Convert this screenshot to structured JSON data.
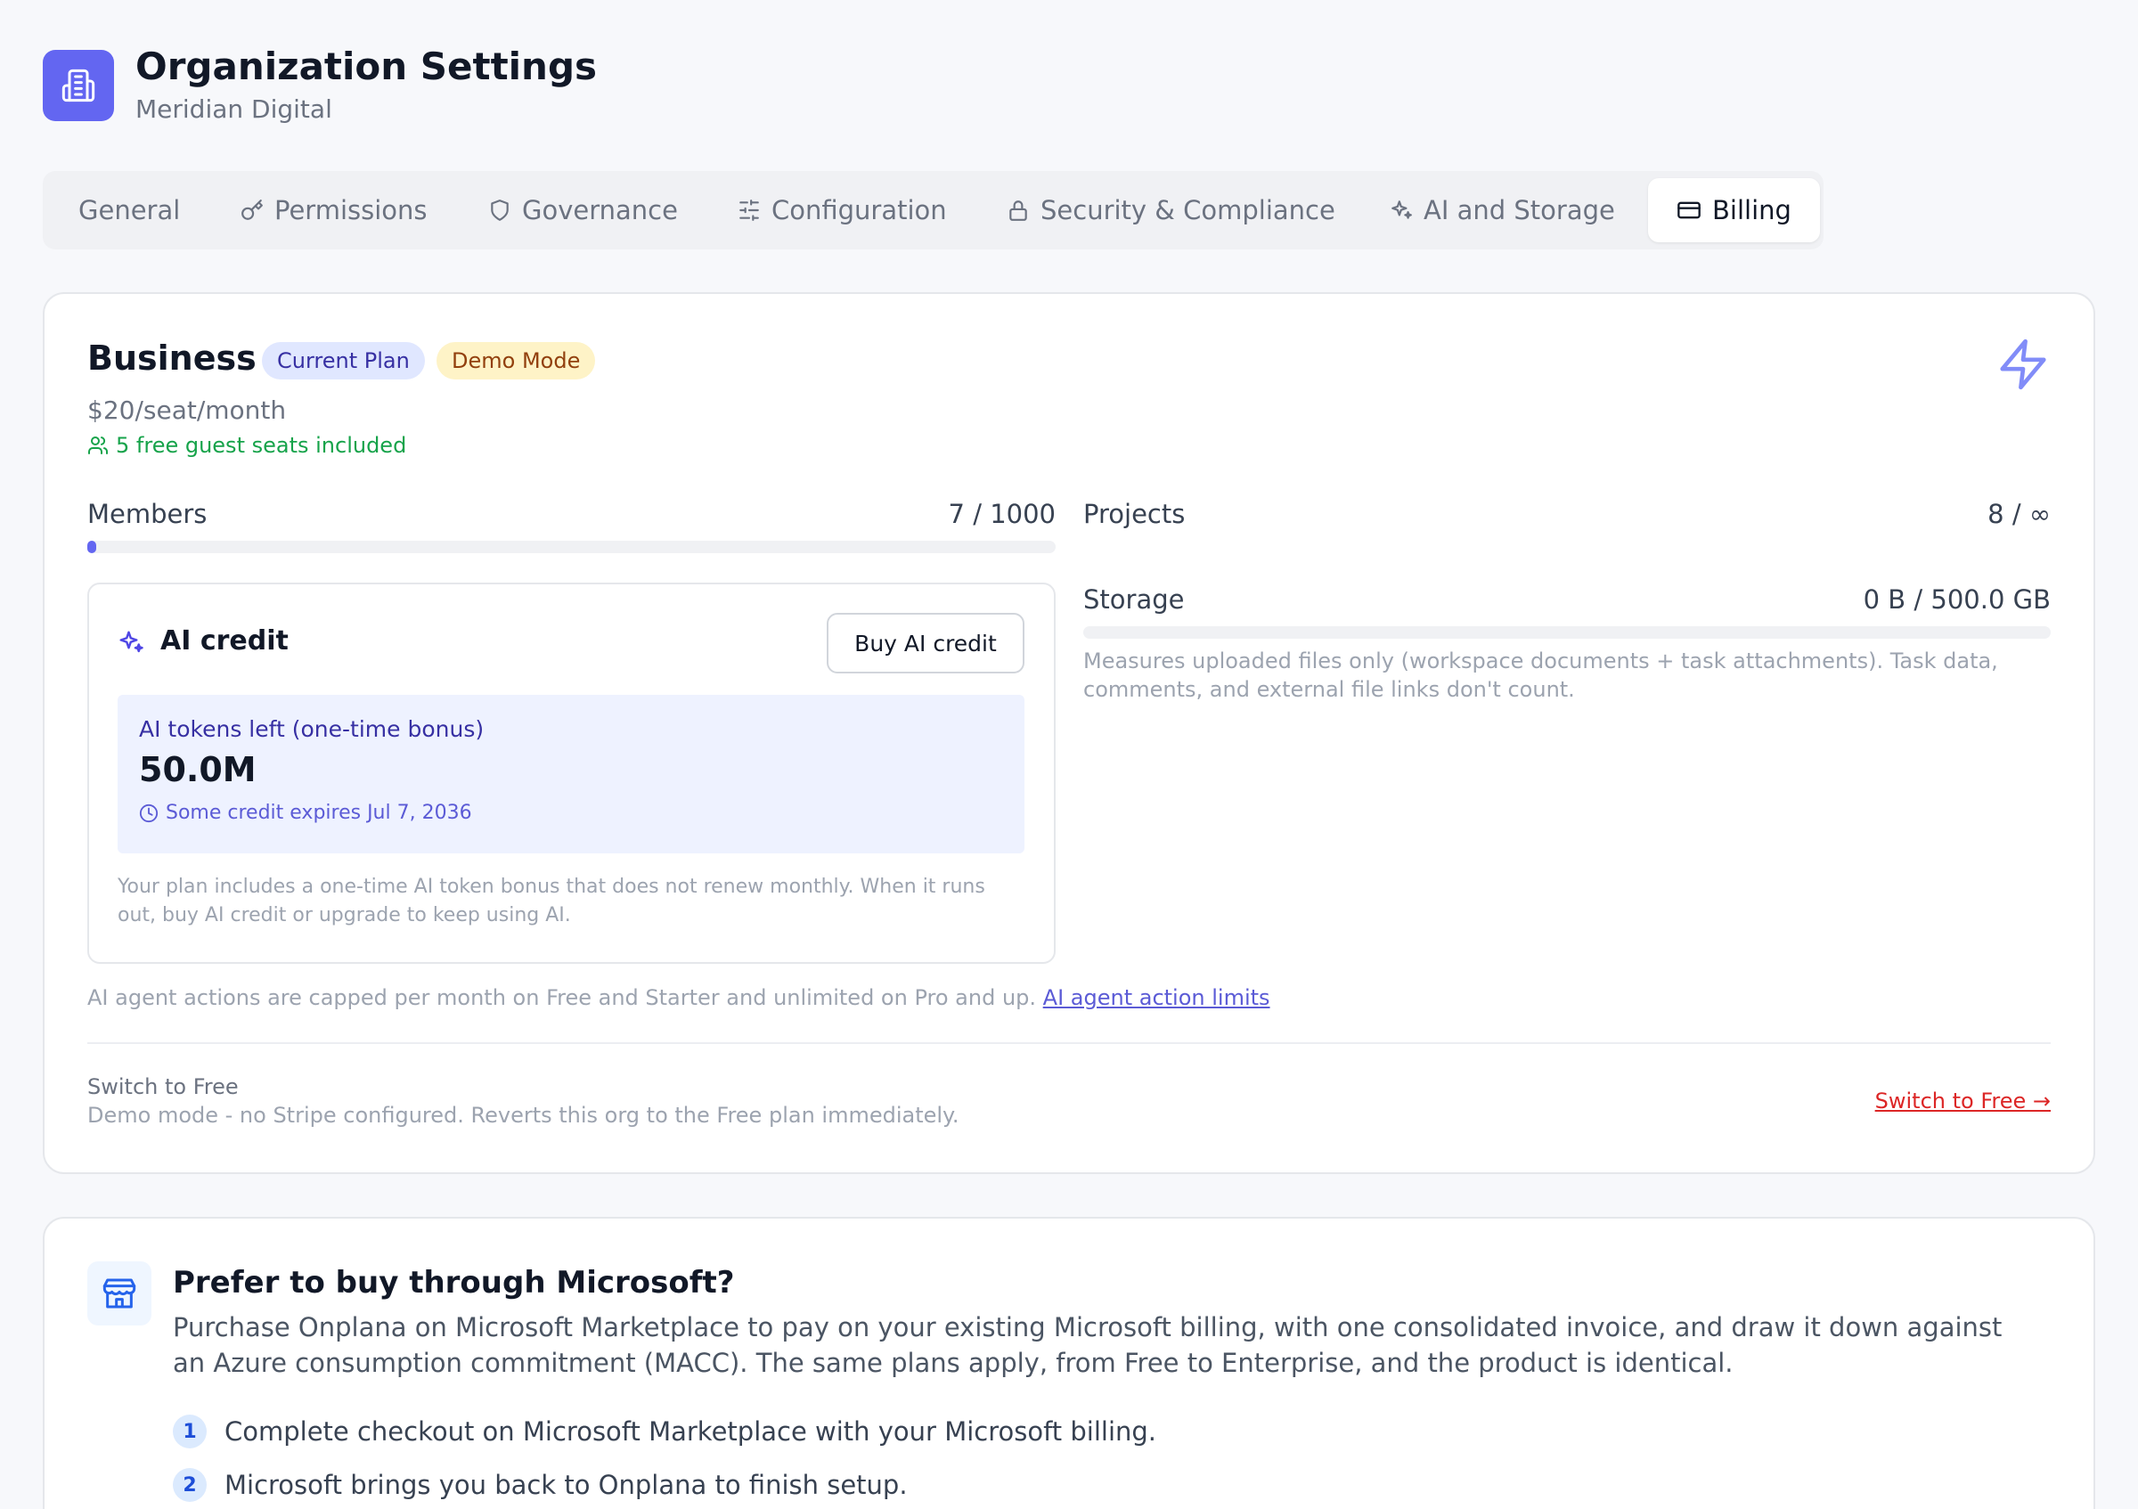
{
  "header": {
    "title": "Organization Settings",
    "org_name": "Meridian Digital",
    "icon": "building-icon"
  },
  "tabs": [
    {
      "label": "General",
      "icon": "",
      "active": false
    },
    {
      "label": "Permissions",
      "icon": "key-icon",
      "active": false
    },
    {
      "label": "Governance",
      "icon": "shield-icon",
      "active": false
    },
    {
      "label": "Configuration",
      "icon": "sliders-icon",
      "active": false
    },
    {
      "label": "Security & Compliance",
      "icon": "lock-icon",
      "active": false
    },
    {
      "label": "AI and Storage",
      "icon": "sparkles-icon",
      "active": false
    },
    {
      "label": "Billing",
      "icon": "credit-card-icon",
      "active": true
    }
  ],
  "plan": {
    "name": "Business",
    "badges": {
      "current": "Current Plan",
      "demo": "Demo Mode"
    },
    "price": "$20/seat/month",
    "guest_seats": "5 free guest seats included",
    "icon": "bolt-icon"
  },
  "usage": {
    "members": {
      "label": "Members",
      "value": "7 / 1000",
      "fraction": 0.007
    },
    "projects": {
      "label": "Projects",
      "value": "8 / ∞"
    },
    "storage": {
      "label": "Storage",
      "value": "0 B / 500.0 GB",
      "fraction": 0,
      "note": "Measures uploaded files only (workspace documents + task attachments). Task data, comments, and external file links don't count."
    }
  },
  "ai_credit": {
    "title": "AI credit",
    "buy_button": "Buy AI credit",
    "tokens_label": "AI tokens left (one-time bonus)",
    "tokens_value": "50.0M",
    "expiry": "Some credit expires Jul 7, 2036",
    "note": "Your plan includes a one-time AI token bonus that does not renew monthly. When it runs out, buy AI credit or upgrade to keep using AI."
  },
  "agent_note": {
    "text": "AI agent actions are capped per month on Free and Starter and unlimited on Pro and up.",
    "link": "AI agent action limits"
  },
  "switch_plan": {
    "title": "Switch to Free",
    "description": "Demo mode - no Stripe configured. Reverts this org to the Free plan immediately.",
    "link": "Switch to Free →"
  },
  "microsoft": {
    "title": "Prefer to buy through Microsoft?",
    "description": "Purchase Onplana on Microsoft Marketplace to pay on your existing Microsoft billing, with one consolidated invoice, and draw it down against an Azure consumption commitment (MACC). The same plans apply, from Free to Enterprise, and the product is identical.",
    "steps": [
      {
        "num": "1",
        "text": "Complete checkout on Microsoft Marketplace with your Microsoft billing."
      },
      {
        "num": "2",
        "text": "Microsoft brings you back to Onplana to finish setup."
      }
    ]
  },
  "colors": {
    "accent": "#6366f1",
    "success": "#16a34a",
    "danger": "#dc2626"
  }
}
